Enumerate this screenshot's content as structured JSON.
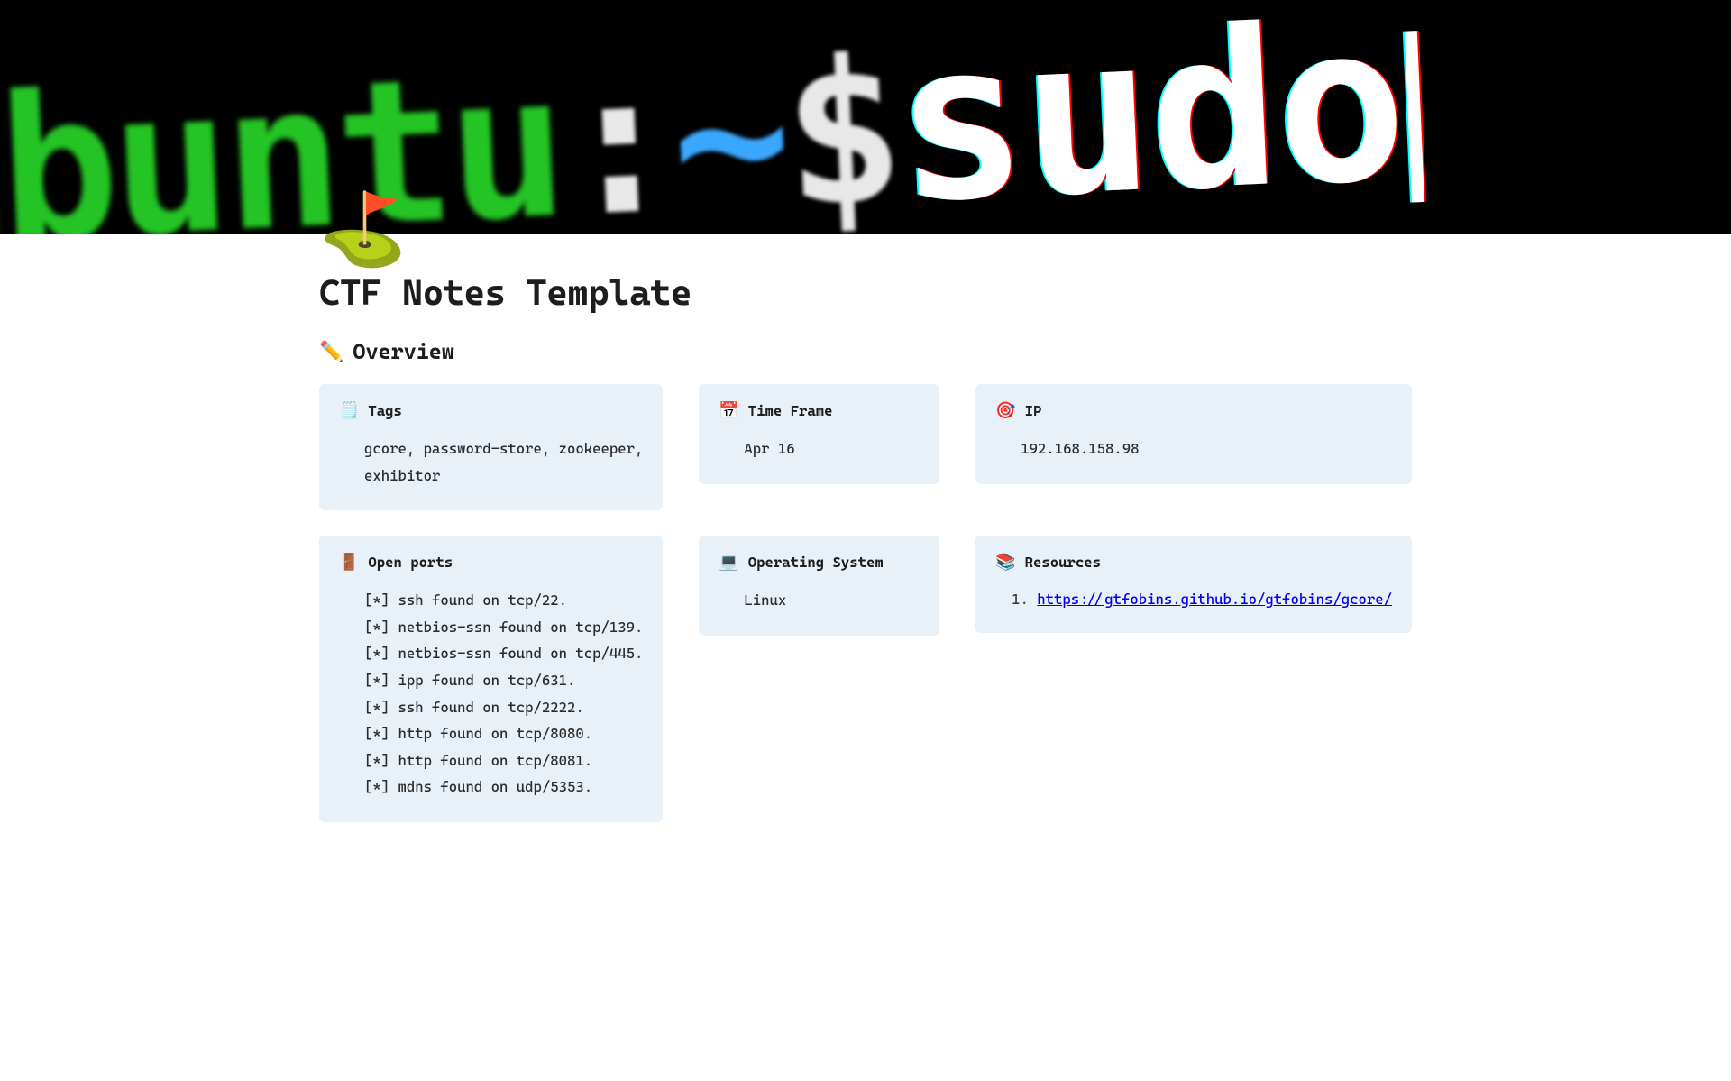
{
  "cover": {
    "segments": [
      {
        "cls": "g1",
        "text": "u"
      },
      {
        "cls": "g2",
        "text": "buntu"
      },
      {
        "cls": "w1",
        "text": ":"
      },
      {
        "cls": "b1",
        "text": "~"
      },
      {
        "cls": "w1",
        "text": "$ "
      },
      {
        "cls": "w2",
        "text": "sudo"
      }
    ]
  },
  "page_icon": "⛳",
  "title": "CTF Notes Template",
  "overview": {
    "emoji": "✏️",
    "label": "Overview"
  },
  "cards": {
    "tags": {
      "emoji": "🗒️",
      "title": "Tags",
      "value": "gcore, password-store, zookeeper, exhibitor"
    },
    "timeframe": {
      "emoji": "📅",
      "title": "Time Frame",
      "value": "Apr 16"
    },
    "ip": {
      "emoji": "🎯",
      "title": "IP",
      "value": "192.168.158.98"
    },
    "ports": {
      "emoji": "🚪",
      "title": "Open ports",
      "lines": [
        "[*] ssh found on tcp/22.",
        "[*] netbios-ssn found on tcp/139.",
        "[*] netbios-ssn found on tcp/445.",
        "[*] ipp found on tcp/631.",
        "[*] ssh found on tcp/2222.",
        "[*] http found on tcp/8080.",
        "[*] http found on tcp/8081.",
        "[*] mdns found on udp/5353."
      ]
    },
    "os": {
      "emoji": "💻",
      "title": "Operating System",
      "value": "Linux"
    },
    "resources": {
      "emoji": "📚",
      "title": "Resources",
      "links": [
        "https://gtfobins.github.io/gtfobins/gcore/"
      ]
    }
  }
}
